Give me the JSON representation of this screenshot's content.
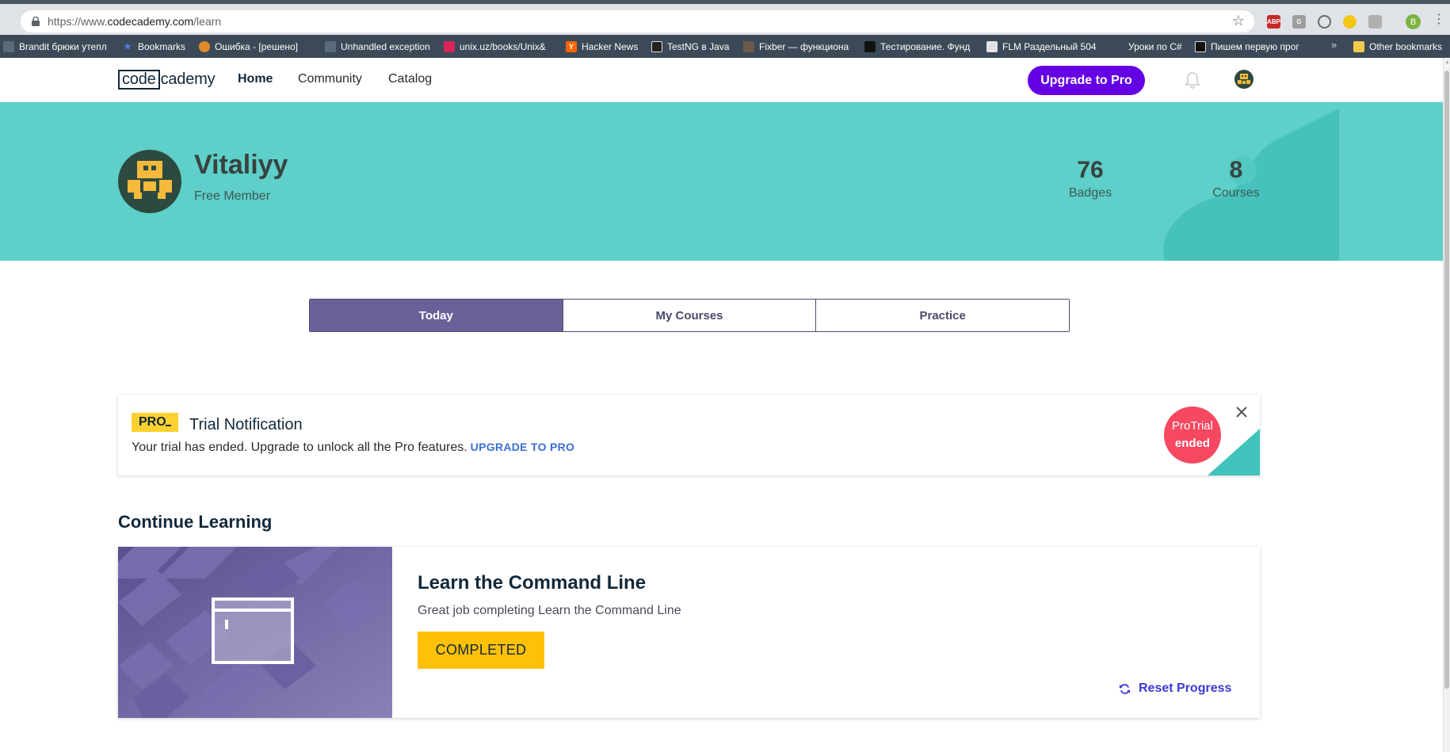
{
  "browser": {
    "url_prefix": "https://www.",
    "url_host": "codecademy.com",
    "url_path": "/learn",
    "avatar_letter": "В",
    "extensions": {
      "abp": "ABP",
      "g": "G"
    },
    "bookmarks": [
      {
        "label": "Brandit брюки утепл",
        "color": "#5a6b7c"
      },
      {
        "label": "Bookmarks",
        "color": "#4a7fe0"
      },
      {
        "label": "Ошибка - [решено]",
        "color": "#e08a2a"
      },
      {
        "label": "Unhandled exception",
        "color": "#5a6b7c"
      },
      {
        "label": "unix.uz/books/Unix&",
        "color": "#d8245a"
      },
      {
        "label": "Hacker News",
        "color": "#ff6600"
      },
      {
        "label": "TestNG в Java",
        "color": "#222222"
      },
      {
        "label": "Fixber — функциона",
        "color": "#6b5a4a"
      },
      {
        "label": "Тестирование. Фунд",
        "color": "#111111"
      },
      {
        "label": "FLM Раздельный 504",
        "color": "#dfe3e8"
      },
      {
        "label": "Уроки по C#",
        "color": "#3c4a58"
      },
      {
        "label": "Пишем первую прог",
        "color": "#111111"
      },
      {
        "label": "Other bookmarks",
        "color": "#f2c94c"
      }
    ],
    "bookmark_overflow": "»"
  },
  "header": {
    "logo_code": "code",
    "logo_academy": "cademy",
    "nav": {
      "home": "Home",
      "community": "Community",
      "catalog": "Catalog"
    },
    "upgrade_label": "Upgrade to Pro"
  },
  "profile": {
    "username": "Vitaliyy",
    "membership": "Free Member",
    "stats": {
      "badges_value": "76",
      "badges_label": "Badges",
      "courses_value": "8",
      "courses_label": "Courses"
    }
  },
  "tabs": {
    "today": "Today",
    "my_courses": "My Courses",
    "practice": "Practice"
  },
  "notice": {
    "badge": "PRO",
    "title": "Trial Notification",
    "body": "Your trial has ended. Upgrade to unlock all the Pro features.",
    "link": "UPGRADE TO PRO",
    "circle_line1": "ProTrial",
    "circle_line2": "ended"
  },
  "continue": {
    "section_title": "Continue Learning",
    "course_title": "Learn the Command Line",
    "course_subtitle": "Great job completing Learn the Command Line",
    "status_label": "COMPLETED",
    "reset_label": "Reset Progress"
  },
  "colors": {
    "brand_purple": "#6400e4",
    "banner_teal": "#5ecfc9",
    "tab_active": "#6b6099",
    "completed_yellow": "#ffc107",
    "trial_red": "#f64860"
  }
}
